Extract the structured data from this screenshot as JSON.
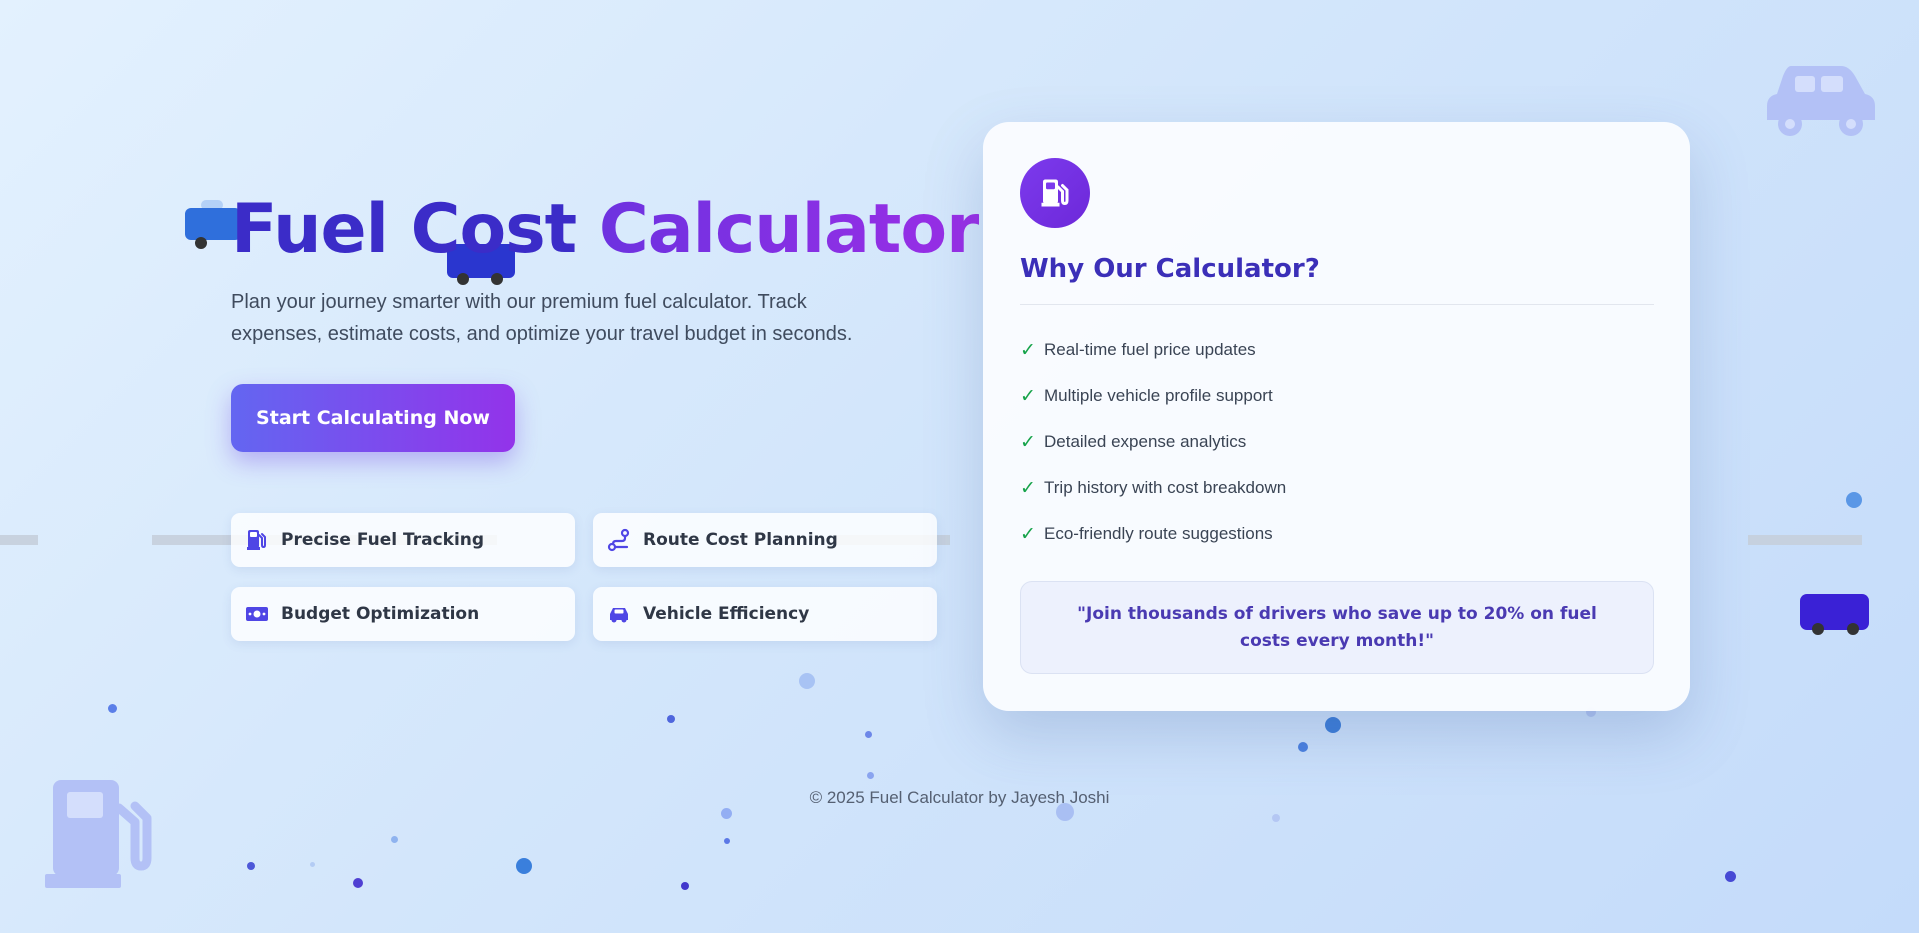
{
  "hero": {
    "title_part1": "Fuel Cost",
    "title_part2": "Calculator",
    "subtitle": "Plan your journey smarter with our premium fuel calculator. Track expenses, estimate costs, and optimize your travel budget in seconds.",
    "cta_label": "Start Calculating Now"
  },
  "features": [
    {
      "label": "Precise Fuel Tracking",
      "icon": "fuel-pump-icon"
    },
    {
      "label": "Route Cost Planning",
      "icon": "route-icon"
    },
    {
      "label": "Budget Optimization",
      "icon": "money-icon"
    },
    {
      "label": "Vehicle Efficiency",
      "icon": "car-icon"
    }
  ],
  "card": {
    "icon": "fuel-pump-icon",
    "heading": "Why Our Calculator?",
    "check_mark": "✓",
    "benefits": [
      "Real-time fuel price updates",
      "Multiple vehicle profile support",
      "Detailed expense analytics",
      "Trip history with cost breakdown",
      "Eco-friendly route suggestions"
    ],
    "quote": "\"Join thousands of drivers who save up to 20% on fuel costs every month!\""
  },
  "footer": {
    "text": "© 2025 Fuel Calculator by Jayesh Joshi"
  },
  "colors": {
    "accent_start": "#6366f1",
    "accent_end": "#9333ea",
    "heading": "#3b2fb8",
    "check": "#16a34a"
  }
}
